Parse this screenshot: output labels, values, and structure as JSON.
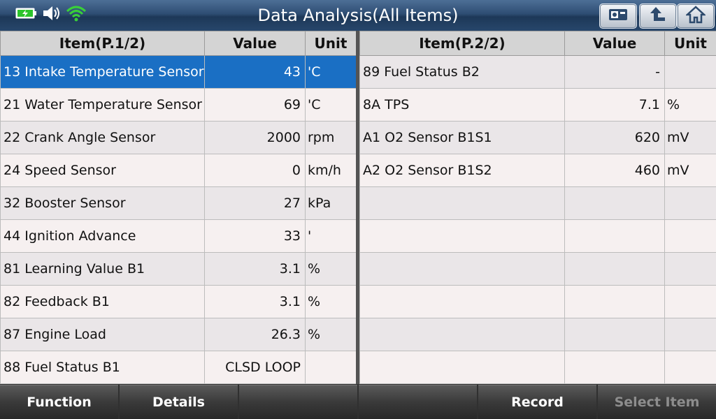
{
  "header": {
    "title": "Data Analysis(All Items)",
    "icons": [
      "battery-charging-icon",
      "speaker-icon",
      "wifi-icon"
    ],
    "buttons": [
      "screenshot-icon",
      "back-arrow-icon",
      "home-icon"
    ]
  },
  "left_table": {
    "headers": {
      "item": "Item(P.1/2)",
      "value": "Value",
      "unit": "Unit"
    },
    "rows": [
      {
        "item": "13 Intake Temperature Sensor",
        "value": "43",
        "unit": "'C"
      },
      {
        "item": "21 Water Temperature Sensor",
        "value": "69",
        "unit": "'C"
      },
      {
        "item": "22 Crank Angle Sensor",
        "value": "2000",
        "unit": "rpm"
      },
      {
        "item": "24 Speed Sensor",
        "value": "0",
        "unit": "km/h"
      },
      {
        "item": "32 Booster Sensor",
        "value": "27",
        "unit": "kPa"
      },
      {
        "item": "44 Ignition Advance",
        "value": "33",
        "unit": "'"
      },
      {
        "item": "81 Learning Value B1",
        "value": "3.1",
        "unit": "%"
      },
      {
        "item": "82 Feedback B1",
        "value": "3.1",
        "unit": "%"
      },
      {
        "item": "87 Engine Load",
        "value": "26.3",
        "unit": "%"
      },
      {
        "item": "88 Fuel Status B1",
        "value": "CLSD LOOP",
        "unit": ""
      }
    ]
  },
  "right_table": {
    "headers": {
      "item": "Item(P.2/2)",
      "value": "Value",
      "unit": "Unit"
    },
    "rows": [
      {
        "item": "89 Fuel Status B2",
        "value": "-",
        "unit": ""
      },
      {
        "item": "8A TPS",
        "value": "7.1",
        "unit": "%"
      },
      {
        "item": "A1 O2 Sensor B1S1",
        "value": "620",
        "unit": "mV"
      },
      {
        "item": "A2 O2 Sensor B1S2",
        "value": "460",
        "unit": "mV"
      },
      {
        "item": "",
        "value": "",
        "unit": ""
      },
      {
        "item": "",
        "value": "",
        "unit": ""
      },
      {
        "item": "",
        "value": "",
        "unit": ""
      },
      {
        "item": "",
        "value": "",
        "unit": ""
      },
      {
        "item": "",
        "value": "",
        "unit": ""
      },
      {
        "item": "",
        "value": "",
        "unit": ""
      }
    ]
  },
  "footer": {
    "buttons": [
      {
        "label": "Function"
      },
      {
        "label": "Details"
      },
      {
        "label": ""
      },
      {
        "label": ""
      },
      {
        "label": "Record"
      },
      {
        "label": "Select Item"
      }
    ]
  },
  "colors": {
    "selection": "#1a6fc4",
    "title_bar": "#2e4d73"
  }
}
